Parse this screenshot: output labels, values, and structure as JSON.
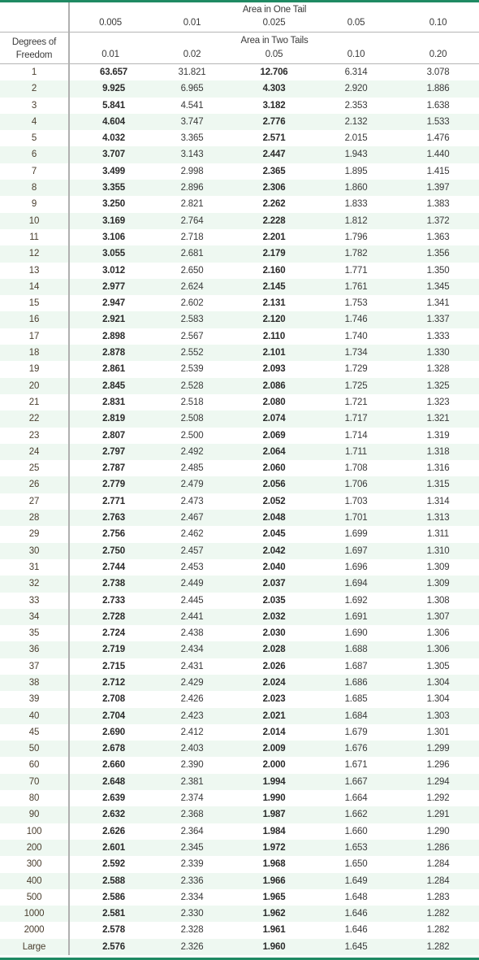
{
  "header": {
    "one_tail_title": "Area in One Tail",
    "one_tail_values": [
      "0.005",
      "0.01",
      "0.025",
      "0.05",
      "0.10"
    ],
    "two_tails_title": "Area in Two Tails",
    "two_tails_values": [
      "0.01",
      "0.02",
      "0.05",
      "0.10",
      "0.20"
    ],
    "df_label_line1": "Degrees of",
    "df_label_line2": "Freedom"
  },
  "colors": {
    "accent_rule": "#1f8a63",
    "stripe": "#eef8f1",
    "divider": "#b0b0b0"
  },
  "bold_columns": [
    0,
    2
  ],
  "rows": [
    {
      "df": "1",
      "values": [
        "63.657",
        "31.821",
        "12.706",
        "6.314",
        "3.078"
      ]
    },
    {
      "df": "2",
      "values": [
        "9.925",
        "6.965",
        "4.303",
        "2.920",
        "1.886"
      ]
    },
    {
      "df": "3",
      "values": [
        "5.841",
        "4.541",
        "3.182",
        "2.353",
        "1.638"
      ]
    },
    {
      "df": "4",
      "values": [
        "4.604",
        "3.747",
        "2.776",
        "2.132",
        "1.533"
      ]
    },
    {
      "df": "5",
      "values": [
        "4.032",
        "3.365",
        "2.571",
        "2.015",
        "1.476"
      ]
    },
    {
      "df": "6",
      "values": [
        "3.707",
        "3.143",
        "2.447",
        "1.943",
        "1.440"
      ]
    },
    {
      "df": "7",
      "values": [
        "3.499",
        "2.998",
        "2.365",
        "1.895",
        "1.415"
      ]
    },
    {
      "df": "8",
      "values": [
        "3.355",
        "2.896",
        "2.306",
        "1.860",
        "1.397"
      ]
    },
    {
      "df": "9",
      "values": [
        "3.250",
        "2.821",
        "2.262",
        "1.833",
        "1.383"
      ]
    },
    {
      "df": "10",
      "values": [
        "3.169",
        "2.764",
        "2.228",
        "1.812",
        "1.372"
      ]
    },
    {
      "df": "11",
      "values": [
        "3.106",
        "2.718",
        "2.201",
        "1.796",
        "1.363"
      ]
    },
    {
      "df": "12",
      "values": [
        "3.055",
        "2.681",
        "2.179",
        "1.782",
        "1.356"
      ]
    },
    {
      "df": "13",
      "values": [
        "3.012",
        "2.650",
        "2.160",
        "1.771",
        "1.350"
      ]
    },
    {
      "df": "14",
      "values": [
        "2.977",
        "2.624",
        "2.145",
        "1.761",
        "1.345"
      ]
    },
    {
      "df": "15",
      "values": [
        "2.947",
        "2.602",
        "2.131",
        "1.753",
        "1.341"
      ]
    },
    {
      "df": "16",
      "values": [
        "2.921",
        "2.583",
        "2.120",
        "1.746",
        "1.337"
      ]
    },
    {
      "df": "17",
      "values": [
        "2.898",
        "2.567",
        "2.110",
        "1.740",
        "1.333"
      ]
    },
    {
      "df": "18",
      "values": [
        "2.878",
        "2.552",
        "2.101",
        "1.734",
        "1.330"
      ]
    },
    {
      "df": "19",
      "values": [
        "2.861",
        "2.539",
        "2.093",
        "1.729",
        "1.328"
      ]
    },
    {
      "df": "20",
      "values": [
        "2.845",
        "2.528",
        "2.086",
        "1.725",
        "1.325"
      ]
    },
    {
      "df": "21",
      "values": [
        "2.831",
        "2.518",
        "2.080",
        "1.721",
        "1.323"
      ]
    },
    {
      "df": "22",
      "values": [
        "2.819",
        "2.508",
        "2.074",
        "1.717",
        "1.321"
      ]
    },
    {
      "df": "23",
      "values": [
        "2.807",
        "2.500",
        "2.069",
        "1.714",
        "1.319"
      ]
    },
    {
      "df": "24",
      "values": [
        "2.797",
        "2.492",
        "2.064",
        "1.711",
        "1.318"
      ]
    },
    {
      "df": "25",
      "values": [
        "2.787",
        "2.485",
        "2.060",
        "1.708",
        "1.316"
      ]
    },
    {
      "df": "26",
      "values": [
        "2.779",
        "2.479",
        "2.056",
        "1.706",
        "1.315"
      ]
    },
    {
      "df": "27",
      "values": [
        "2.771",
        "2.473",
        "2.052",
        "1.703",
        "1.314"
      ]
    },
    {
      "df": "28",
      "values": [
        "2.763",
        "2.467",
        "2.048",
        "1.701",
        "1.313"
      ]
    },
    {
      "df": "29",
      "values": [
        "2.756",
        "2.462",
        "2.045",
        "1.699",
        "1.311"
      ]
    },
    {
      "df": "30",
      "values": [
        "2.750",
        "2.457",
        "2.042",
        "1.697",
        "1.310"
      ]
    },
    {
      "df": "31",
      "values": [
        "2.744",
        "2.453",
        "2.040",
        "1.696",
        "1.309"
      ]
    },
    {
      "df": "32",
      "values": [
        "2.738",
        "2.449",
        "2.037",
        "1.694",
        "1.309"
      ]
    },
    {
      "df": "33",
      "values": [
        "2.733",
        "2.445",
        "2.035",
        "1.692",
        "1.308"
      ]
    },
    {
      "df": "34",
      "values": [
        "2.728",
        "2.441",
        "2.032",
        "1.691",
        "1.307"
      ]
    },
    {
      "df": "35",
      "values": [
        "2.724",
        "2.438",
        "2.030",
        "1.690",
        "1.306"
      ]
    },
    {
      "df": "36",
      "values": [
        "2.719",
        "2.434",
        "2.028",
        "1.688",
        "1.306"
      ]
    },
    {
      "df": "37",
      "values": [
        "2.715",
        "2.431",
        "2.026",
        "1.687",
        "1.305"
      ]
    },
    {
      "df": "38",
      "values": [
        "2.712",
        "2.429",
        "2.024",
        "1.686",
        "1.304"
      ]
    },
    {
      "df": "39",
      "values": [
        "2.708",
        "2.426",
        "2.023",
        "1.685",
        "1.304"
      ]
    },
    {
      "df": "40",
      "values": [
        "2.704",
        "2.423",
        "2.021",
        "1.684",
        "1.303"
      ]
    },
    {
      "df": "45",
      "values": [
        "2.690",
        "2.412",
        "2.014",
        "1.679",
        "1.301"
      ]
    },
    {
      "df": "50",
      "values": [
        "2.678",
        "2.403",
        "2.009",
        "1.676",
        "1.299"
      ]
    },
    {
      "df": "60",
      "values": [
        "2.660",
        "2.390",
        "2.000",
        "1.671",
        "1.296"
      ]
    },
    {
      "df": "70",
      "values": [
        "2.648",
        "2.381",
        "1.994",
        "1.667",
        "1.294"
      ]
    },
    {
      "df": "80",
      "values": [
        "2.639",
        "2.374",
        "1.990",
        "1.664",
        "1.292"
      ]
    },
    {
      "df": "90",
      "values": [
        "2.632",
        "2.368",
        "1.987",
        "1.662",
        "1.291"
      ]
    },
    {
      "df": "100",
      "values": [
        "2.626",
        "2.364",
        "1.984",
        "1.660",
        "1.290"
      ]
    },
    {
      "df": "200",
      "values": [
        "2.601",
        "2.345",
        "1.972",
        "1.653",
        "1.286"
      ]
    },
    {
      "df": "300",
      "values": [
        "2.592",
        "2.339",
        "1.968",
        "1.650",
        "1.284"
      ]
    },
    {
      "df": "400",
      "values": [
        "2.588",
        "2.336",
        "1.966",
        "1.649",
        "1.284"
      ]
    },
    {
      "df": "500",
      "values": [
        "2.586",
        "2.334",
        "1.965",
        "1.648",
        "1.283"
      ]
    },
    {
      "df": "1000",
      "values": [
        "2.581",
        "2.330",
        "1.962",
        "1.646",
        "1.282"
      ]
    },
    {
      "df": "2000",
      "values": [
        "2.578",
        "2.328",
        "1.961",
        "1.646",
        "1.282"
      ]
    },
    {
      "df": "Large",
      "values": [
        "2.576",
        "2.326",
        "1.960",
        "1.645",
        "1.282"
      ]
    }
  ]
}
